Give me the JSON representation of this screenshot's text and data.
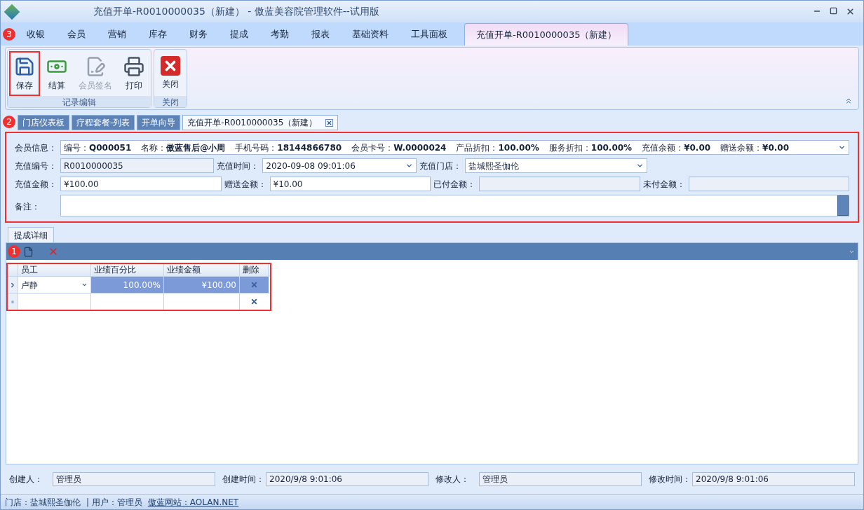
{
  "window": {
    "title": "充值开单-R0010000035（新建） - 傲蓝美容院管理软件--试用版"
  },
  "menu_tabs": [
    {
      "label": "收银",
      "selected": false
    },
    {
      "label": "会员",
      "selected": false
    },
    {
      "label": "营销",
      "selected": false
    },
    {
      "label": "库存",
      "selected": false
    },
    {
      "label": "财务",
      "selected": false
    },
    {
      "label": "提成",
      "selected": false
    },
    {
      "label": "考勤",
      "selected": false
    },
    {
      "label": "报表",
      "selected": false
    },
    {
      "label": "基础资料",
      "selected": false
    },
    {
      "label": "工具面板",
      "selected": false
    },
    {
      "label": "充值开单-R0010000035（新建）",
      "selected": true
    }
  ],
  "ribbon": {
    "groups": [
      {
        "title": "记录编辑",
        "buttons": [
          {
            "label": "保存",
            "kind": "save",
            "disabled": false,
            "highlighted": true
          },
          {
            "label": "结算",
            "kind": "money",
            "disabled": false,
            "highlighted": false
          },
          {
            "label": "会员签名",
            "kind": "sign",
            "disabled": true,
            "highlighted": false
          },
          {
            "label": "打印",
            "kind": "print",
            "disabled": false,
            "highlighted": false
          }
        ]
      },
      {
        "title": "关闭",
        "buttons": [
          {
            "label": "关闭",
            "kind": "close",
            "disabled": false,
            "highlighted": false
          }
        ]
      }
    ]
  },
  "doc_tabs": [
    {
      "label": "门店仪表板",
      "selected": false
    },
    {
      "label": "疗程套餐-列表",
      "selected": false
    },
    {
      "label": "开单向导",
      "selected": false
    },
    {
      "label": "充值开单-R0010000035（新建）",
      "selected": true
    }
  ],
  "form": {
    "highlighted": true,
    "member_info": {
      "label": "会员信息：",
      "fields": [
        {
          "label": "编号：",
          "value": "Q000051"
        },
        {
          "label": "名称：",
          "value": "傲蓝售后@小周"
        },
        {
          "label": "手机号码：",
          "value": "18144866780"
        },
        {
          "label": "会员卡号：",
          "value": "W.0000024"
        },
        {
          "label": "产品折扣：",
          "value": "100.00%"
        },
        {
          "label": "服务折扣：",
          "value": "100.00%"
        },
        {
          "label": "充值余额：",
          "value": "¥0.00"
        },
        {
          "label": "赠送余额：",
          "value": "¥0.00"
        }
      ]
    },
    "rows": [
      [
        {
          "label": "充值编号：",
          "value": "R0010000035",
          "kind": "readonly"
        },
        {
          "label": "充值时间：",
          "value": "2020-09-08 09:01:06",
          "kind": "dropdown"
        },
        {
          "label": "充值门店：",
          "value": "盐城熙圣伽伦",
          "kind": "dropdown"
        }
      ],
      [
        {
          "label": "充值金额：",
          "value": "¥100.00",
          "kind": "text"
        },
        {
          "label": "赠送金额：",
          "value": "¥10.00",
          "kind": "text"
        },
        {
          "label": "已付金额：",
          "kind": "readonly"
        },
        {
          "label": "未付金额：",
          "kind": "readonly"
        }
      ]
    ],
    "remark": {
      "label": "备注："
    }
  },
  "detail": {
    "tab": "提成详细",
    "highlighted": true,
    "columns": [
      "员工",
      "业绩百分比",
      "业绩金额",
      "删除"
    ],
    "rows": [
      {
        "kind": "data",
        "selected": true,
        "cells": [
          "卢静",
          "100.00%",
          "¥100.00"
        ]
      },
      {
        "kind": "new",
        "selected": false,
        "cells": [
          "",
          "",
          ""
        ]
      }
    ]
  },
  "callouts": {
    "menu": "3",
    "doc_tabs": "2",
    "detail": "1"
  },
  "footer": [
    {
      "label": "创建人：",
      "value": "管理员"
    },
    {
      "label": "创建时间：",
      "value": "2020/9/8 9:01:06"
    },
    {
      "label": "修改人：",
      "value": "管理员"
    },
    {
      "label": "修改时间：",
      "value": "2020/9/8 9:01:06"
    }
  ],
  "status_bar": {
    "store": "门店：盐城熙圣伽伦",
    "user": "| 用户：管理员",
    "link": "傲蓝网站：AOLAN.NET"
  }
}
